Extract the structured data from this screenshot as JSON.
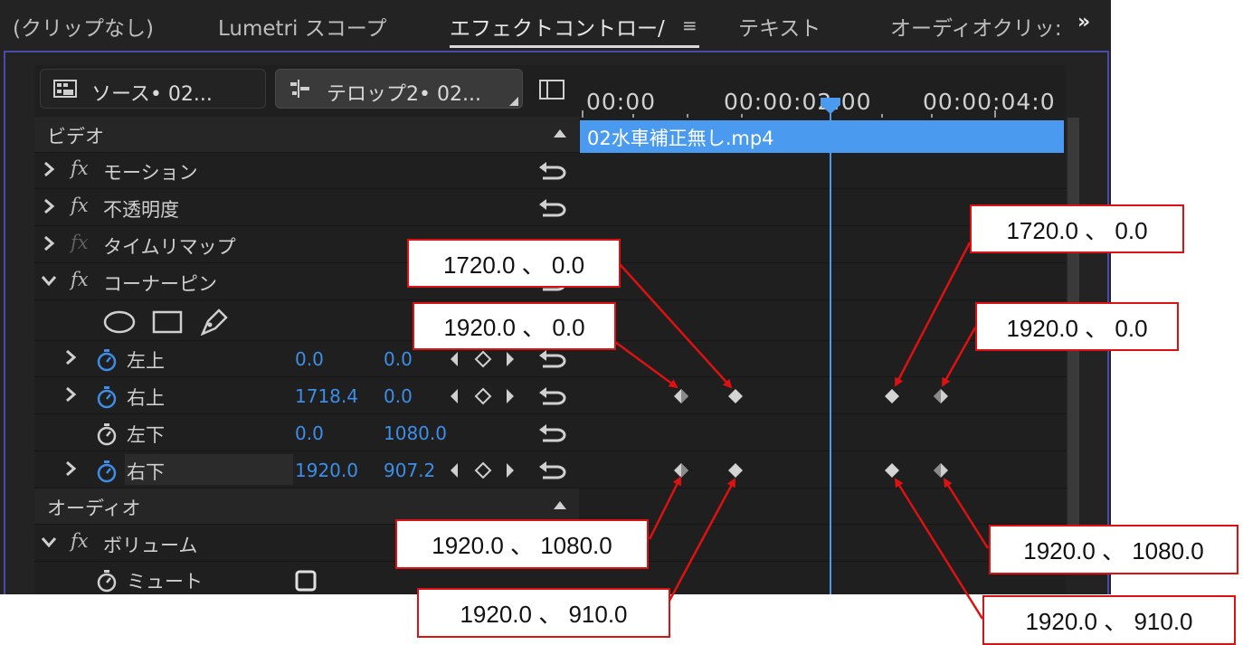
{
  "tabs": [
    {
      "label": "(クリップなし)"
    },
    {
      "label": "Lumetri スコープ"
    },
    {
      "label": "エフェクトコントロー/"
    },
    {
      "label": "テキスト"
    },
    {
      "label": "オーディオクリッ:"
    }
  ],
  "tab_menu_symbol": "≡",
  "more_symbol": "»",
  "source_buttons": {
    "source": "ソース• 02...",
    "telop": "テロップ2• 02..."
  },
  "sections": {
    "video": "ビデオ",
    "audio": "オーディオ"
  },
  "effects": {
    "motion": "モーション",
    "opacity": "不透明度",
    "time_remap": "タイムリマップ",
    "corner_pin": "コーナーピン",
    "volume": "ボリューム",
    "fx": "fx"
  },
  "params": [
    {
      "name": "左上",
      "x": "0.0",
      "y": "0.0"
    },
    {
      "name": "右上",
      "x": "1718.4",
      "y": "0.0"
    },
    {
      "name": "左下",
      "x": "0.0",
      "y": "1080.0"
    },
    {
      "name": "右下",
      "x": "1920.0",
      "y": "907.2"
    }
  ],
  "mute_label": "ミュート",
  "ruler": [
    "00:00",
    "00:00:02:00",
    "00:00:04:0"
  ],
  "clip_name": "02水車補正無し.mp4",
  "callouts": [
    "1720.0 、 0.0",
    "1920.0 、 0.0",
    "1720.0 、 0.0",
    "1920.0 、 0.0",
    "1920.0 、 1080.0",
    "1920.0 、 910.0",
    "1920.0 、 1080.0",
    "1920.0 、 910.0"
  ],
  "colors": {
    "accent": "#4a9bf0",
    "value_blue": "#3d8ee8",
    "callout_red": "#dd1111",
    "panel_bg": "#232323"
  }
}
